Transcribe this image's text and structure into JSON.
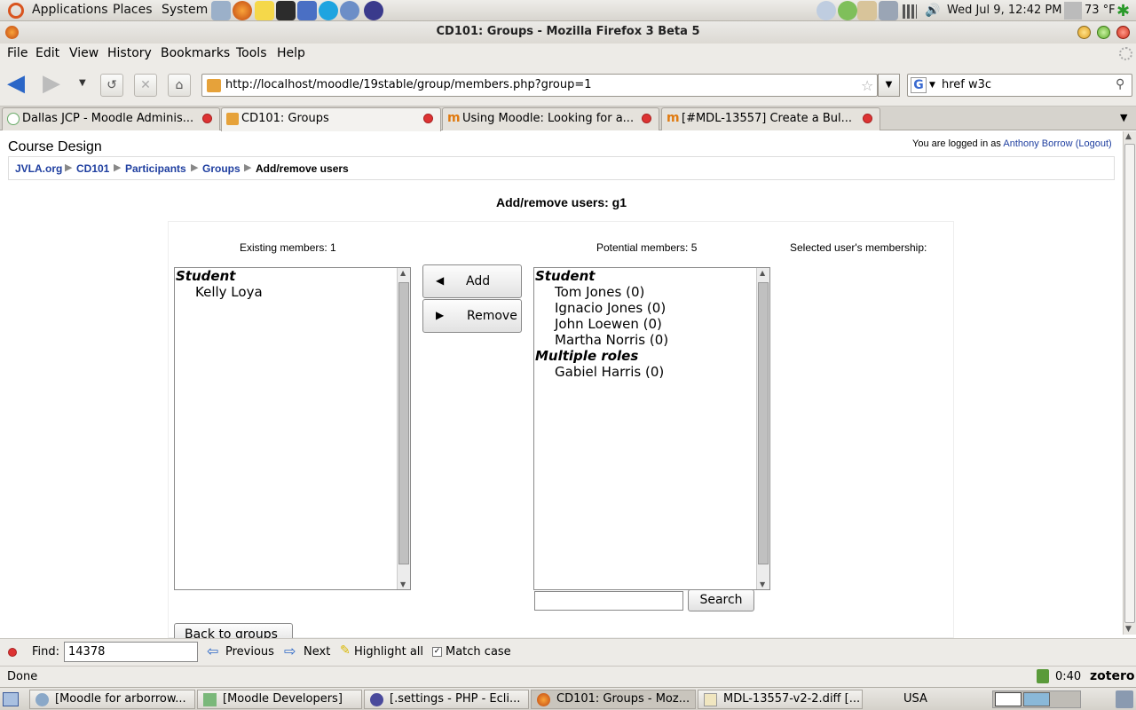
{
  "top_panel": {
    "applications": "Applications",
    "places": "Places",
    "system": "System",
    "clock": "Wed Jul  9, 12:42 PM",
    "weather": "73 °F"
  },
  "window": {
    "title": "CD101: Groups - Mozilla Firefox 3 Beta 5"
  },
  "menubar": {
    "items": [
      "File",
      "Edit",
      "View",
      "History",
      "Bookmarks",
      "Tools",
      "Help"
    ]
  },
  "navbar": {
    "url": "http://localhost/moodle/19stable/group/members.php?group=1",
    "search_value": "href w3c"
  },
  "tabs": [
    {
      "label": "Dallas JCP - Moodle Adminis..."
    },
    {
      "label": "CD101: Groups"
    },
    {
      "label": "Using Moodle: Looking for a..."
    },
    {
      "label": "[#MDL-13557] Create a Bul..."
    }
  ],
  "page": {
    "site_title": "Course Design",
    "login_prefix": "You are logged in as",
    "login_user": "Anthony Borrow",
    "logout": "(Logout)",
    "breadcrumb": [
      "JVLA.org",
      "CD101",
      "Participants",
      "Groups",
      "Add/remove users"
    ],
    "heading": "Add/remove users: g1",
    "existing_label": "Existing members: 1",
    "potential_label": "Potential members: 5",
    "selected_label": "Selected user's membership:",
    "existing": {
      "group": "Student",
      "members": [
        "Kelly Loya"
      ]
    },
    "potential": {
      "groups": [
        {
          "name": "Student",
          "members": [
            "Tom Jones (0)",
            "Ignacio Jones (0)",
            "John Loewen (0)",
            "Martha Norris (0)"
          ]
        },
        {
          "name": "Multiple roles",
          "members": [
            "Gabiel Harris (0)"
          ]
        }
      ]
    },
    "add_button": "Add",
    "remove_button": "Remove",
    "search_button": "Search",
    "search_value": "",
    "back_button": "Back to groups"
  },
  "findbar": {
    "label": "Find:",
    "value": "14378",
    "previous": "Previous",
    "next": "Next",
    "highlight": "Highlight all",
    "match_case": "Match case"
  },
  "statusbar": {
    "status": "Done",
    "timer": "0:40",
    "zotero": "zotero"
  },
  "taskbar": {
    "items": [
      "[Moodle for arborrow...",
      "[Moodle Developers]",
      "[.settings - PHP - Ecli...",
      "CD101: Groups - Moz...",
      "MDL-13557-v2-2.diff [..."
    ],
    "keyboard": "USA"
  },
  "colors": {
    "link": "#1f3fa0",
    "panel": "#edebe7",
    "close_red": "#dd3333"
  }
}
